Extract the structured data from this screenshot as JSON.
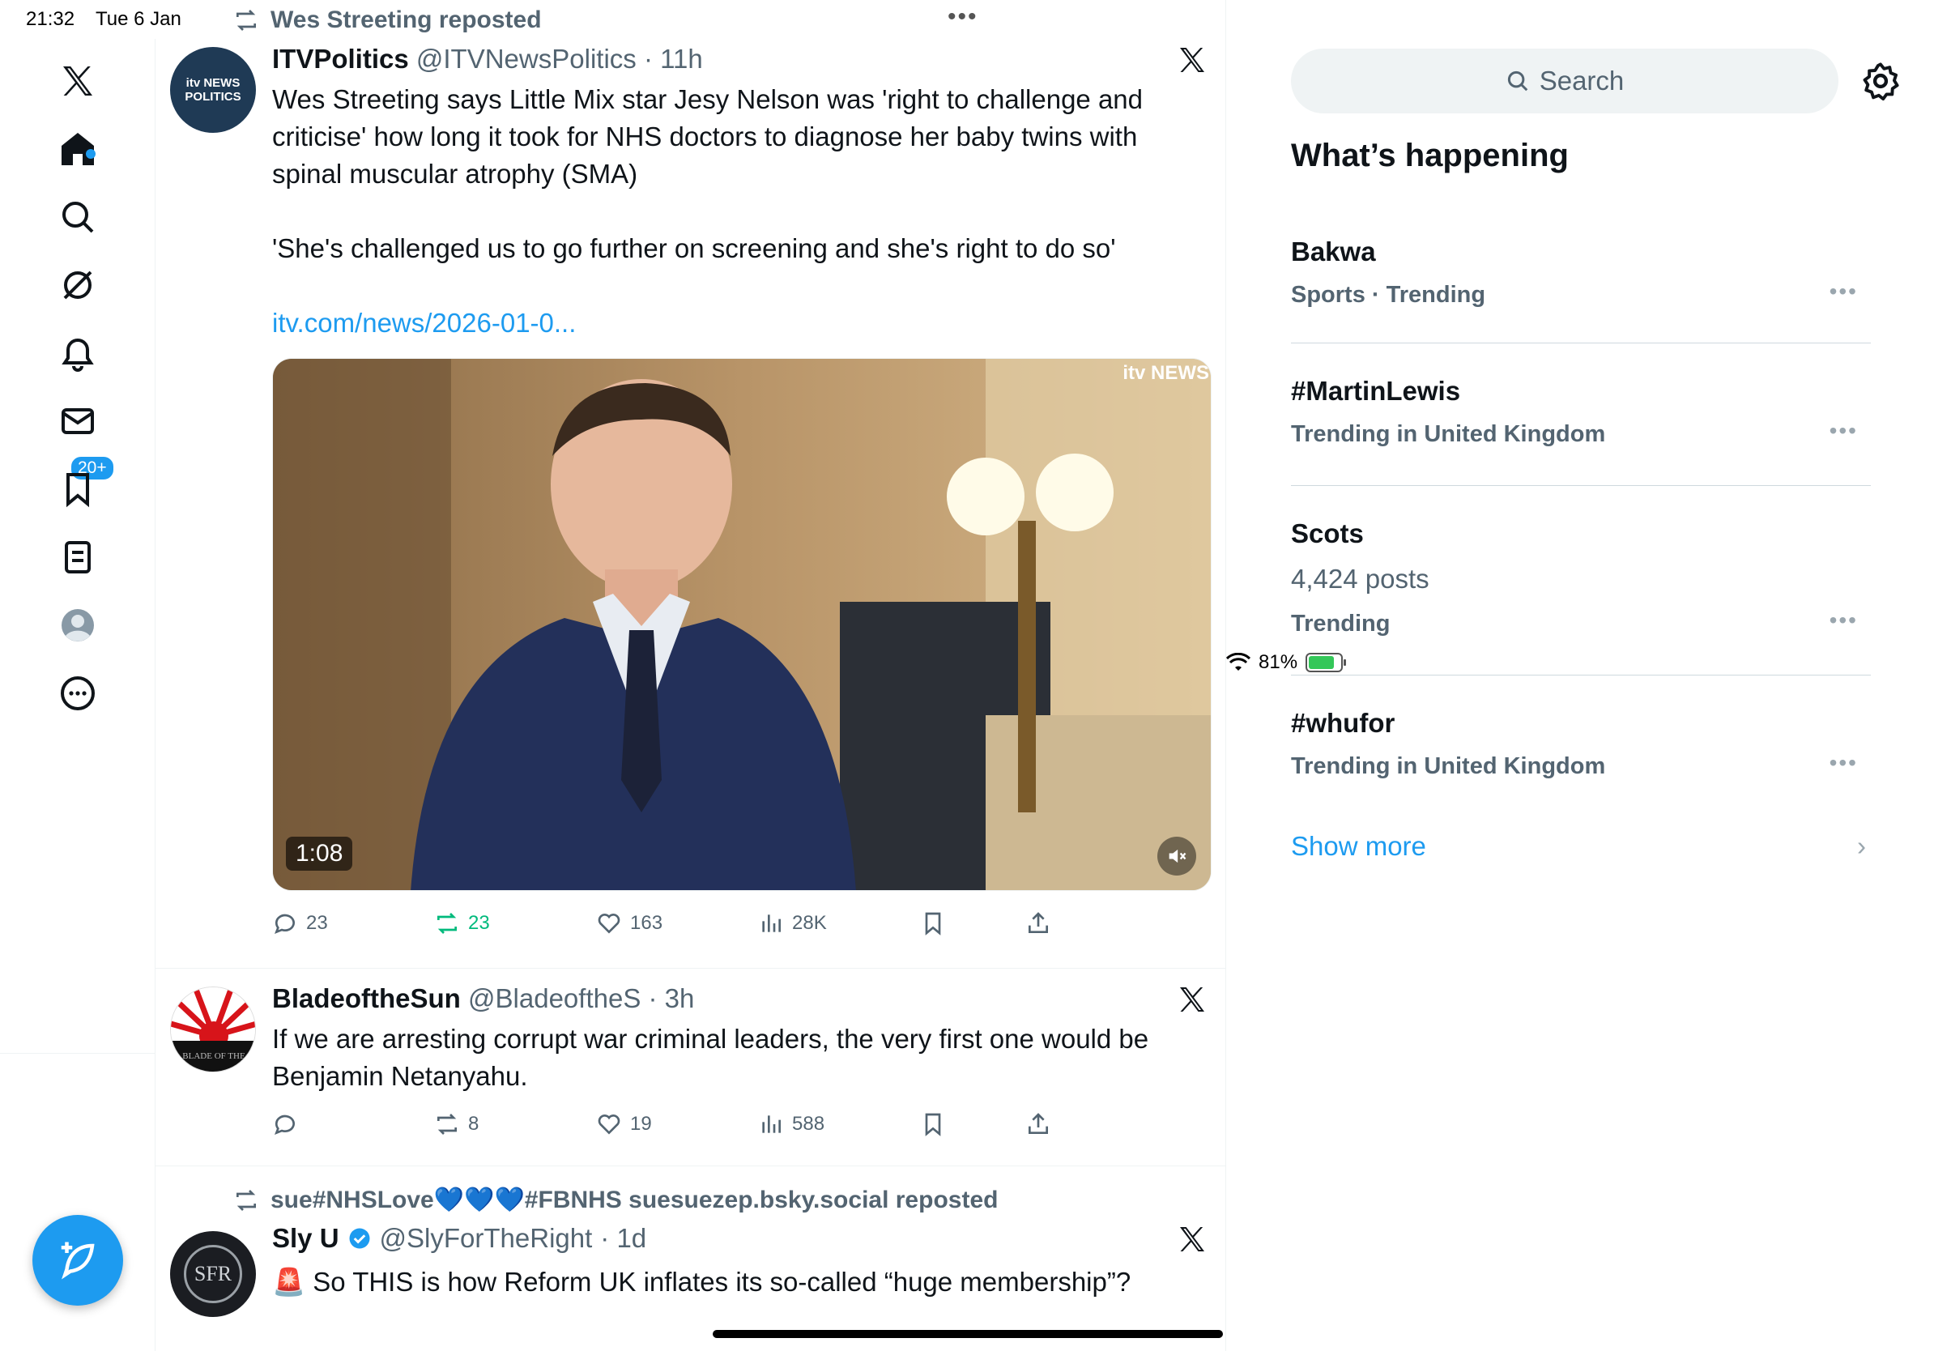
{
  "status": {
    "time": "21:32",
    "date": "Tue 6 Jan",
    "battery": "81%",
    "battery_level": 0.81
  },
  "nav": {
    "notifications_badge": "20+"
  },
  "feed": {
    "posts": [
      {
        "repost_by": "Wes Streeting reposted",
        "name": "ITVPolitics",
        "handle": "@ITVNewsPolitics",
        "time": "· 11h",
        "avatar_text_1": "itv NEWS",
        "avatar_text_2": "POLITICS",
        "text": "Wes Streeting says Little Mix star Jesy Nelson was 'right to challenge and criticise' how long it took for NHS doctors to diagnose her baby twins with spinal muscular atrophy (SMA)",
        "quote": "'She's challenged us to go further on screening and she's right to do so'",
        "link": "itv.com/news/2026-01-0...",
        "media_watermark": "itv NEWS",
        "video_duration": "1:08",
        "replies": "23",
        "reposts": "23",
        "likes": "163",
        "views": "28K"
      },
      {
        "name": "BladeoftheSun",
        "handle": "@BladeoftheS",
        "time": "· 3h",
        "avatar_text": "BLADE OF THE",
        "text": "If we are arresting corrupt war criminal leaders, the very first one would be Benjamin Netanyahu.",
        "replies": "",
        "reposts": "8",
        "likes": "19",
        "views": "588"
      },
      {
        "repost_by": "sue#NHSLove💙💙💙#FBNHS suesuezep.bsky.social reposted",
        "name": "Sly U",
        "handle": "@SlyForTheRight",
        "time": "· 1d",
        "avatar_text": "SFR",
        "text": "🚨 So THIS is how Reform UK inflates its so-called “huge membership”?"
      }
    ]
  },
  "sidebar": {
    "search_placeholder": "Search",
    "title": "What’s happening",
    "trends": [
      {
        "name": "Bakwa",
        "meta": "Sports · Trending",
        "posts": ""
      },
      {
        "name": "#MartinLewis",
        "meta": "Trending in United Kingdom",
        "posts": ""
      },
      {
        "name": "Scots",
        "posts": "4,424 posts",
        "meta": "Trending"
      },
      {
        "name": "#whufor",
        "meta": "Trending in United Kingdom",
        "posts": ""
      }
    ],
    "show_more": "Show more"
  },
  "colors": {
    "accent": "#1d9bf0",
    "repost_green": "#00ba7c",
    "secondary_text": "#536471"
  }
}
